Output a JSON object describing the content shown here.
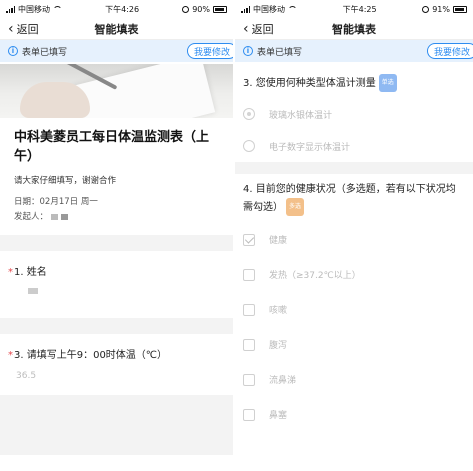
{
  "left": {
    "status": {
      "carrier": "中国移动",
      "time": "下午4:26",
      "battery": "90%"
    },
    "nav": {
      "back_label": "返回",
      "title": "智能填表"
    },
    "notice": {
      "text": "表单已填写",
      "edit_label": "我要修改"
    },
    "form": {
      "title": "中科美菱员工每日体温监测表（上午）",
      "description": "请大家仔细填写，谢谢合作",
      "date_line": "日期：02月17日 周一",
      "initiator_label": "发起人："
    },
    "questions": [
      {
        "required": "*",
        "label": "1. 姓名"
      },
      {
        "required": "*",
        "label": "3. 请填写上午9：00时体温（℃）",
        "value": "36.5"
      }
    ]
  },
  "right": {
    "status": {
      "carrier": "中国移动",
      "time": "下午4:25",
      "battery": "91%"
    },
    "nav": {
      "back_label": "返回",
      "title": "智能填表"
    },
    "notice": {
      "text": "表单已填写",
      "edit_label": "我要修改"
    },
    "q3": {
      "label": "3. 您使用何种类型体温计测量",
      "tag": "单选",
      "options": [
        "玻璃水银体温计",
        "电子数字显示体温计"
      ],
      "selected": 0
    },
    "q4": {
      "label": "4. 目前您的健康状况（多选题，若有以下状况均需勾选）",
      "tag": "多选",
      "options": [
        "健康",
        "发热（≥37.2℃以上）",
        "咳嗽",
        "腹泻",
        "流鼻涕",
        "鼻塞"
      ],
      "checked": [
        0
      ]
    }
  }
}
